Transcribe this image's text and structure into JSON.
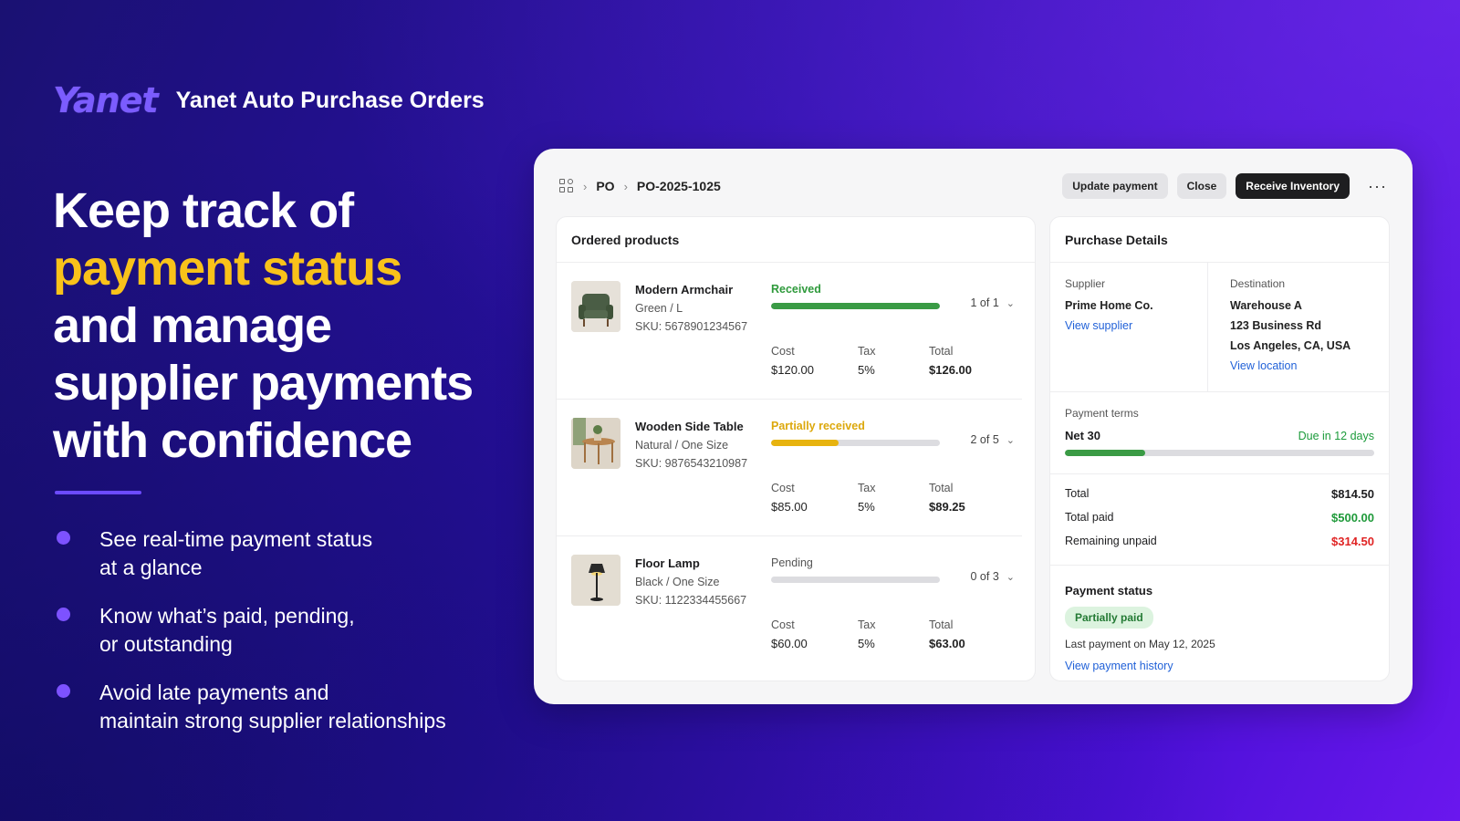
{
  "brand": {
    "logo": "Yanet",
    "title": "Yanet Auto Purchase Orders"
  },
  "headline": {
    "line1": "Keep track of",
    "line2": "payment status",
    "line3": "and manage",
    "line4": "supplier payments",
    "line5": "with confidence"
  },
  "bullets": [
    {
      "line1": "See real-time payment status",
      "line2": "at a glance"
    },
    {
      "line1": "Know what’s paid, pending,",
      "line2": "or outstanding"
    },
    {
      "line1": "Avoid late payments and",
      "line2": "maintain strong supplier relationships"
    }
  ],
  "colors": {
    "accent": "#7d52ff",
    "highlight": "#f9c21a",
    "received": "#3a9b45",
    "partial": "#e7b30f",
    "unpaid": "#e02424"
  },
  "breadcrumb": {
    "icon": "grid-icon",
    "root": "PO",
    "current": "PO-2025-1025"
  },
  "toolbar": {
    "update_payment": "Update payment",
    "close": "Close",
    "receive_inventory": "Receive Inventory",
    "more": "···"
  },
  "ordered_products": {
    "title": "Ordered products",
    "labels": {
      "cost": "Cost",
      "tax": "Tax",
      "total": "Total"
    },
    "items": [
      {
        "name": "Modern Armchair",
        "variant": "Green / L",
        "sku": "SKU: 5678901234567",
        "status": "Received",
        "status_color": "#2f9a3c",
        "progress": 1.0,
        "bar_color": "#3a9b45",
        "count": "1 of 1",
        "cost": "$120.00",
        "tax": "5%",
        "total": "$126.00"
      },
      {
        "name": "Wooden Side Table",
        "variant": "Natural / One Size",
        "sku": "SKU: 9876543210987",
        "status": "Partially received",
        "status_color": "#dca80c",
        "progress": 0.4,
        "bar_color": "#e7b30f",
        "count": "2 of 5",
        "cost": "$85.00",
        "tax": "5%",
        "total": "$89.25"
      },
      {
        "name": "Floor Lamp",
        "variant": "Black / One Size",
        "sku": "SKU: 1122334455667",
        "status": "Pending",
        "status_color": "#555555",
        "progress": 0.0,
        "bar_color": "#bdbdc2",
        "count": "0 of 3",
        "cost": "$60.00",
        "tax": "5%",
        "total": "$63.00"
      }
    ]
  },
  "purchase_details": {
    "title": "Purchase Details",
    "supplier_label": "Supplier",
    "supplier_name": "Prime Home Co.",
    "view_supplier": "View supplier",
    "destination_label": "Destination",
    "destination_name": "Warehouse A",
    "address1": "123 Business Rd",
    "address2": "Los Angeles, CA, USA",
    "view_location": "View location",
    "terms_label": "Payment terms",
    "terms_value": "Net 30",
    "terms_due": "Due in 12 days",
    "terms_progress": 0.26,
    "total_label": "Total",
    "total_value": "$814.50",
    "paid_label": "Total paid",
    "paid_value": "$500.00",
    "remaining_label": "Remaining unpaid",
    "remaining_value": "$314.50",
    "status_title": "Payment status",
    "status_badge": "Partially paid",
    "last_payment": "Last payment on May 12, 2025",
    "view_history": "View payment history"
  }
}
